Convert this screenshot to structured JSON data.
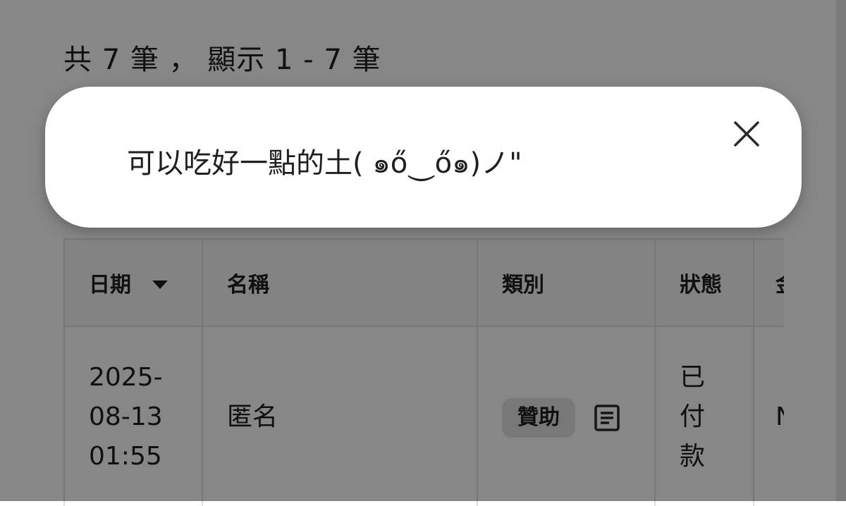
{
  "summary": {
    "text": "共 7 筆 ， 顯示 1 - 7 筆"
  },
  "table": {
    "headers": {
      "date": "日期",
      "name": "名稱",
      "category": "類別",
      "status": "狀態",
      "amount": "金"
    },
    "rows": [
      {
        "date_line1": "2025-",
        "date_line2": "08-13",
        "date_line3": "01:55",
        "name": "匿名",
        "category": "贊助",
        "status_line1": "已",
        "status_line2": "付",
        "status_line3": "款",
        "amount": "N"
      }
    ]
  },
  "toast": {
    "message": "可以吃好一點的土( ๑ő⏝ő๑)ノ\"",
    "close_icon": "close-icon"
  },
  "icons": {
    "sort": "caret-down-icon",
    "note": "document-icon"
  }
}
